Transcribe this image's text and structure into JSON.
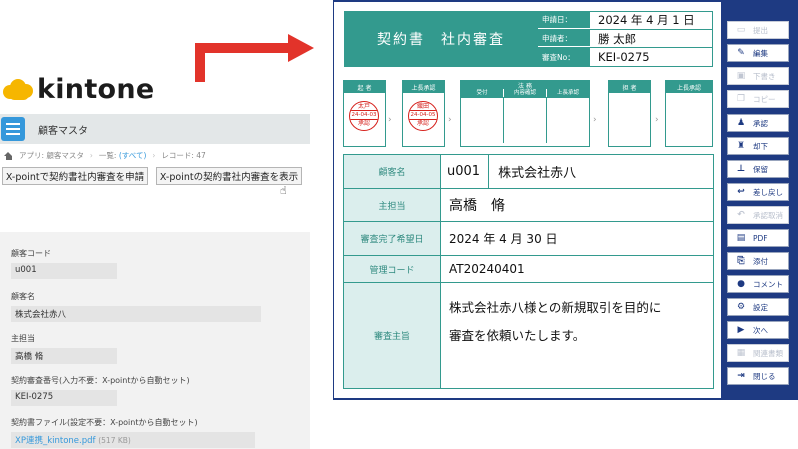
{
  "kintone": {
    "logo_text": "kintone",
    "app_title": "顧客マスタ",
    "breadcrumb": {
      "app": "アプリ: 顧客マスタ",
      "list_prefix": "一覧: ",
      "list_link": "(すべて)",
      "record": "レコード: 47"
    },
    "buttons": {
      "apply": "X-pointで契約書社内審査を申請",
      "show": "X-pointの契約書社内審査を表示"
    },
    "fields": {
      "customer_code_label": "顧客コード",
      "customer_code_value": "u001",
      "customer_name_label": "顧客名",
      "customer_name_value": "株式会社赤八",
      "manager_label": "主担当",
      "manager_value": "高橋 脩",
      "contract_no_label": "契約審査番号(入力不要：X-pointから自動セット)",
      "contract_no_value": "KEI-0275",
      "contract_file_label": "契約書ファイル(設定不要：X-pointから自動セット)",
      "contract_file_link": "XP連携_kintone.pdf",
      "contract_file_size": "(517 KB)"
    }
  },
  "xpoint": {
    "title": "契約書　社内審査",
    "meta": {
      "date_label": "申請日：",
      "date_value": "2024 年 4 月 1 日",
      "applicant_label": "申請者：",
      "applicant_value": "勝 太郎",
      "no_label": "審査No：",
      "no_value": "KEI-0275"
    },
    "approvals": {
      "box1": "起 者",
      "box2": "上長承認",
      "box3": "法 務",
      "box3_sub": [
        "受付",
        "内容確認",
        "上長承認"
      ],
      "box4": "担 者",
      "box5": "上長承認"
    },
    "stamps": {
      "a_name": "太戸",
      "a_date": "24-04-03",
      "a_status": "承認",
      "b_name": "織田",
      "b_date": "24-04-05",
      "b_status": "承認"
    },
    "table": {
      "customer_label": "顧客名",
      "customer_code": "u001",
      "customer_name": "株式会社赤八",
      "manager_label": "主担当",
      "manager_value": "高橋　脩",
      "due_label": "審査完了希望日",
      "due_value": "2024 年 4 月 30 日",
      "code_label": "管理コード",
      "code_value": "AT20240401",
      "reason_label": "審査主旨",
      "reason_line1": "株式会社赤八様との新規取引を目的に",
      "reason_line2": "審査を依頼いたします。"
    },
    "toolbar": {
      "b1": "提出",
      "b2": "編集",
      "b3": "下書き",
      "b4": "コピー",
      "b5": "承認",
      "b6": "却下",
      "b7": "保留",
      "b8": "差し戻し",
      "b9": "承認取消",
      "b10": "PDF",
      "b11": "添付",
      "b12": "コメント",
      "b13": "設定",
      "b14": "次へ",
      "b15": "関連書類",
      "b16": "閉じる"
    }
  },
  "colors": {
    "teal": "#339a8e",
    "navy": "#1e3a82",
    "arrow_red": "#e2332a",
    "stamp_red": "#d6221d",
    "kintone_blue": "#3598db",
    "kintone_yellow": "#f6b600"
  }
}
